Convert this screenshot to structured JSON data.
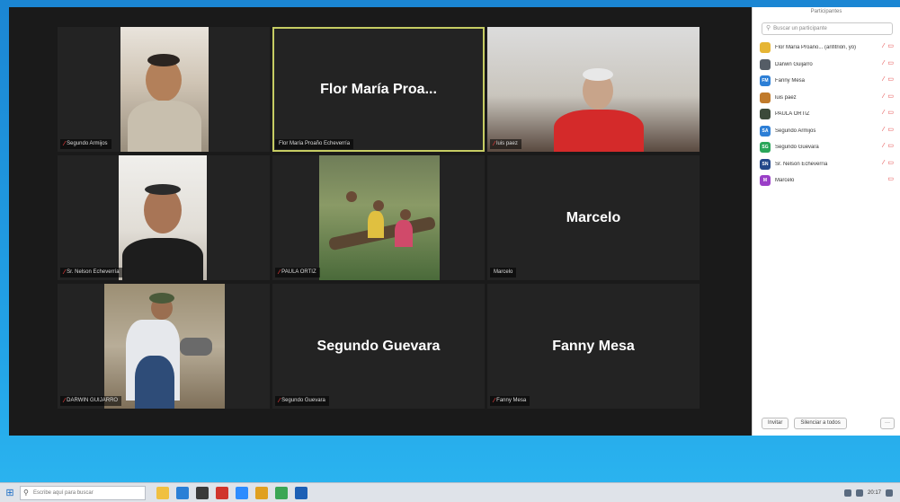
{
  "panel": {
    "title": "Participantes",
    "search_placeholder": "Buscar un participante",
    "participants": [
      {
        "initials": "",
        "name": "Flor María Proaño... (anfitrión, yo)",
        "color": "#e6b534"
      },
      {
        "initials": "",
        "name": "Darwin Guijarro",
        "color": "#555d66"
      },
      {
        "initials": "FM",
        "name": "Fanny Mesa",
        "color": "#2d7fd6"
      },
      {
        "initials": "",
        "name": "luis paez",
        "color": "#c07a2b"
      },
      {
        "initials": "",
        "name": "PAULA ORTIZ",
        "color": "#3c4a3a"
      },
      {
        "initials": "SA",
        "name": "Segundo Armijos",
        "color": "#2d7fd6"
      },
      {
        "initials": "SG",
        "name": "Segundo Guevara",
        "color": "#2aa65a"
      },
      {
        "initials": "SN",
        "name": "Sr. Nelson Echeverría",
        "color": "#24488a"
      },
      {
        "initials": "M",
        "name": "Marcelo",
        "color": "#9a3fc7"
      }
    ],
    "invite_label": "Invitar",
    "mute_all_label": "Silenciar a todos",
    "more_label": "···"
  },
  "gallery": {
    "tiles": [
      {
        "label": "Segundo Armijos",
        "big_name": ""
      },
      {
        "label": "Flor María Proaño Echeverría",
        "big_name": "Flor María Proa..."
      },
      {
        "label": "luis paez",
        "big_name": ""
      },
      {
        "label": "Sr. Nelson Echeverría",
        "big_name": ""
      },
      {
        "label": "PAULA ORTIZ",
        "big_name": ""
      },
      {
        "label": "Marcelo",
        "big_name": "Marcelo"
      },
      {
        "label": "DARWIN GUIJARRO",
        "big_name": ""
      },
      {
        "label": "Segundo Guevara",
        "big_name": "Segundo Guevara"
      },
      {
        "label": "Fanny Mesa",
        "big_name": "Fanny Mesa"
      }
    ]
  },
  "taskbar": {
    "search_placeholder": "Escribe aquí para buscar",
    "clock": "20:17"
  },
  "colors": {
    "active_speaker_border": "#c6cc63",
    "muted_icon": "#e23c3c"
  }
}
